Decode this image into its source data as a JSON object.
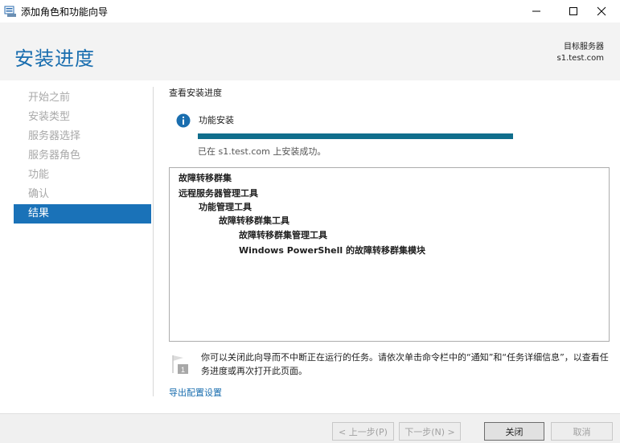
{
  "window": {
    "title": "添加角色和功能向导"
  },
  "header": {
    "page_title": "安装进度",
    "server_label": "目标服务器",
    "server_name": "s1.test.com"
  },
  "nav": {
    "items": [
      {
        "label": "开始之前",
        "active": false
      },
      {
        "label": "安装类型",
        "active": false
      },
      {
        "label": "服务器选择",
        "active": false
      },
      {
        "label": "服务器角色",
        "active": false
      },
      {
        "label": "功能",
        "active": false
      },
      {
        "label": "确认",
        "active": false
      },
      {
        "label": "结果",
        "active": true
      }
    ]
  },
  "main": {
    "section_title": "查看安装进度",
    "feature_title": "功能安装",
    "progress_percent": 100,
    "status_text": "已在 s1.test.com 上安装成功。",
    "results": [
      {
        "label": "故障转移群集",
        "level": 0
      },
      {
        "label": "远程服务器管理工具",
        "level": 0
      },
      {
        "label": "功能管理工具",
        "level": 1
      },
      {
        "label": "故障转移群集工具",
        "level": 2
      },
      {
        "label": "故障转移群集管理工具",
        "level": 3
      },
      {
        "label": "Windows PowerShell 的故障转移群集模块",
        "level": 3
      }
    ],
    "note_text": "你可以关闭此向导而不中断正在运行的任务。请依次单击命令栏中的“通知”和“任务详细信息”，以查看任务进度或再次打开此页面。",
    "export_link": "导出配置设置"
  },
  "footer": {
    "prev_label": "< 上一步(P)",
    "next_label": "下一步(N) >",
    "close_label": "关闭",
    "cancel_label": "取消"
  },
  "colors": {
    "accent": "#1a72b8",
    "progress": "#106e8c",
    "title_blue": "#1a6eaf"
  }
}
